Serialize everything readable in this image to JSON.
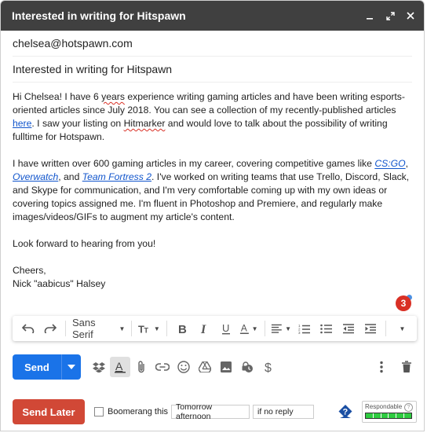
{
  "window": {
    "title": "Interested in writing for Hitspawn"
  },
  "to": "chelsea@hotspawn.com",
  "subject": "Interested in writing for Hitspawn",
  "body": {
    "p1_a": "Hi Chelsea! I have 6 ",
    "p1_years": "years",
    "p1_b": " experience writing gaming articles and have been writing esports-oriented articles since July 2018. You can see a collection of my recently-published articles ",
    "p1_here": "here",
    "p1_c": ". I saw your listing on ",
    "p1_hitmarker": "Hitmarker",
    "p1_d": " and would love to talk about the possibility of writing fulltime for Hotspawn.",
    "p2_a": "I have written over 600 gaming articles in my career, covering competitive games like ",
    "p2_csgo": "CS:GO",
    "p2_b": ", ",
    "p2_overwatch": "Overwatch",
    "p2_c": ", and ",
    "p2_tf2": "Team Fortress 2",
    "p2_d": ". I've worked on writing teams that use Trello, Discord, Slack, and Skype for communication, and I'm very comfortable coming up with my own ideas or covering topics assigned me. I'm fluent in Photoshop and Premiere, and regularly make images/videos/GIFs to augment my article's content.",
    "p3": "Look forward to hearing from you!",
    "p4": "Cheers,",
    "p5": "Nick \"aabicus\" Halsey"
  },
  "badge_count": "3",
  "format_bar": {
    "font": "Sans Serif"
  },
  "send_label": "Send",
  "send_later_label": "Send Later",
  "boomerang": {
    "label": "Boomerang this",
    "when": "Tomorrow afternoon",
    "condition": "if no reply"
  },
  "respondable": {
    "label": "Respondable",
    "level": 1.0
  },
  "colors": {
    "titlebar": "#404040",
    "send": "#1a73e8",
    "send_later": "#d14836",
    "badge": "#d93025",
    "link": "#1155cc"
  }
}
